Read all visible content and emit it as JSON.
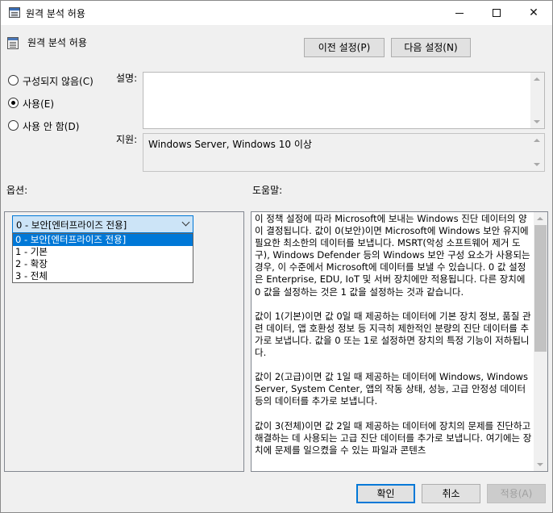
{
  "window": {
    "title": "원격 분석 허용",
    "minimize_glyph": "—",
    "close_glyph": "✕"
  },
  "header": {
    "policy_title": "원격 분석 허용",
    "prev_setting": "이전 설정(P)",
    "next_setting": "다음 설정(N)"
  },
  "state": {
    "options": [
      {
        "label": "구성되지 않음(C)",
        "selected": false
      },
      {
        "label": "사용(E)",
        "selected": true
      },
      {
        "label": "사용 안 함(D)",
        "selected": false
      }
    ]
  },
  "fields": {
    "comment_label": "설명:",
    "comment_value": "",
    "supported_label": "지원:",
    "supported_value": "Windows Server, Windows 10 이상"
  },
  "sections": {
    "options_label": "옵션:",
    "help_label": "도움말:"
  },
  "options_panel": {
    "selected_value": "0 - 보안[엔터프라이즈 전용]",
    "dropdown_items": [
      "0 - 보안[엔터프라이즈 전용]",
      "1 - 기본",
      "2 - 확장",
      "3 - 전체"
    ]
  },
  "help": {
    "paragraphs": [
      "이 정책 설정에 따라 Microsoft에 보내는 Windows 진단 데이터의 양이 결정됩니다. 값이 0(보안)이면 Microsoft에 Windows 보안 유지에 필요한 최소한의 데이터를 보냅니다. MSRT(악성 소프트웨어 제거 도구), Windows Defender 등의 Windows 보안 구성 요소가 사용되는 경우, 이 수준에서 Microsoft에 데이터를 보낼 수 있습니다. 0 값 설정은 Enterprise, EDU, IoT 및 서버 장치에만 적용됩니다. 다른 장치에 0 값을 설정하는 것은 1 값을 설정하는 것과 같습니다.",
      "값이 1(기본)이면 값 0일 때 제공하는 데이터에 기본 장치 정보, 품질 관련 데이터, 앱 호환성 정보 등 지극히 제한적인 분량의 진단 데이터를 추가로 보냅니다. 값을 0 또는 1로 설정하면 장치의 특정 기능이 저하됩니다.",
      "값이 2(고급)이면 값 1일 때 제공하는 데이터에 Windows, Windows Server, System Center, 앱의 작동 상태, 성능, 고급 안정성 데이터 등의 데이터를 추가로 보냅니다.",
      "값이 3(전체)이면 값 2일 때 제공하는 데이터에 장치의 문제를 진단하고 해결하는 데 사용되는 고급 진단 데이터를 추가로 보냅니다. 여기에는 장치에 문제를 일으켰을 수 있는 파일과 콘텐츠"
    ]
  },
  "footer": {
    "ok": "확인",
    "cancel": "취소",
    "apply": "적용(A)"
  }
}
